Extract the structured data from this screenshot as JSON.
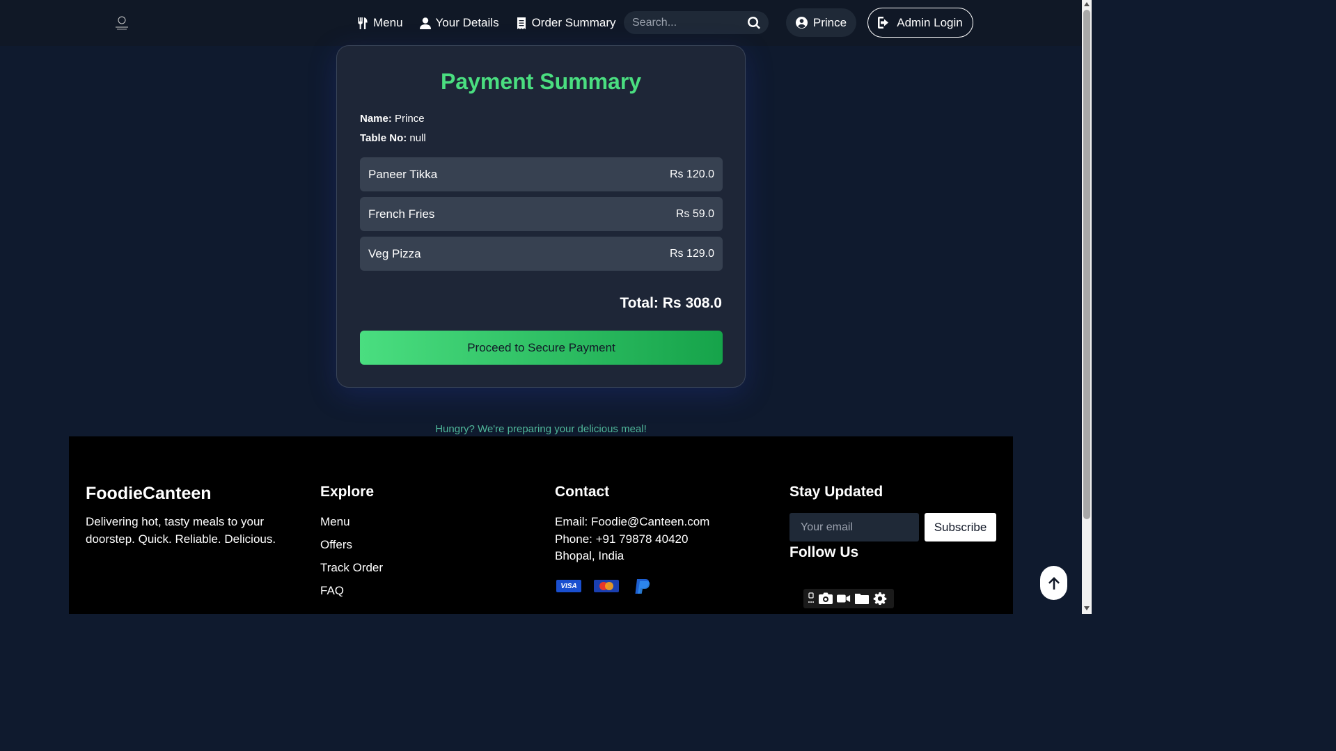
{
  "nav": {
    "links": [
      {
        "label": "Menu",
        "icon": "utensils-icon"
      },
      {
        "label": "Your Details",
        "icon": "user-icon"
      },
      {
        "label": "Order Summary",
        "icon": "receipt-icon"
      }
    ],
    "search_placeholder": "Search...",
    "user_label": "Prince",
    "admin_label": "Admin Login"
  },
  "payment": {
    "title": "Payment Summary",
    "name_label": "Name:",
    "name_value": "Prince",
    "table_label": "Table No:",
    "table_value": "null",
    "items": [
      {
        "name": "Paneer Tikka",
        "price": "Rs 120.0"
      },
      {
        "name": "French Fries",
        "price": "Rs 59.0"
      },
      {
        "name": "Veg Pizza",
        "price": "Rs 129.0"
      }
    ],
    "total": "Total: Rs 308.0",
    "button_label": "Proceed to Secure Payment"
  },
  "tagline": "Hungry? We're preparing your delicious meal!",
  "footer": {
    "brand": "FoodieCanteen",
    "brand_desc": "Delivering hot, tasty meals to your doorstep. Quick. Reliable. Delicious.",
    "explore_title": "Explore",
    "explore_links": [
      "Menu",
      "Offers",
      "Track Order",
      "FAQ"
    ],
    "contact_title": "Contact",
    "contact_email": "Email: Foodie@Canteen.com",
    "contact_phone": "Phone: +91 79878 40420",
    "contact_city": "Bhopal, India",
    "payment_icons": [
      "visa-icon",
      "mastercard-icon",
      "paypal-icon"
    ],
    "stay_title": "Stay Updated",
    "email_placeholder": "Your email",
    "subscribe_label": "Subscribe",
    "follow_title": "Follow Us"
  },
  "colors": {
    "background": "#0f1a2e",
    "navbar": "#101826",
    "card": "#1e2637",
    "accent_green": "#4ade80",
    "footer": "#000000"
  }
}
